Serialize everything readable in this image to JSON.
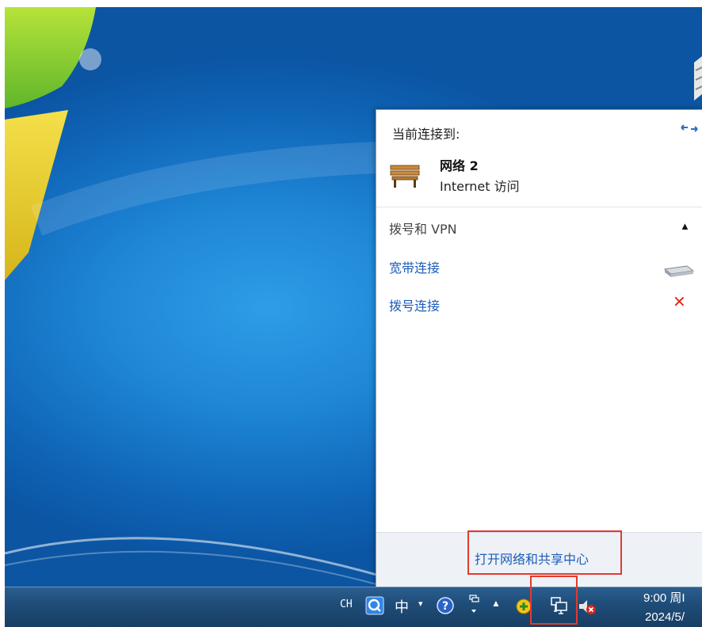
{
  "popup": {
    "current_label": "当前连接到:",
    "network_name": "网络  2",
    "network_access": "Internet 访问",
    "section_title": "拨号和 VPN",
    "connections": [
      {
        "label": "宽带连接"
      },
      {
        "label": "拨号连接"
      }
    ],
    "open_center": "打开网络和共享中心"
  },
  "taskbar": {
    "lang": "CH",
    "ime_mode": "中",
    "clock_time": "9:00 周I",
    "clock_date": "2024/5/"
  },
  "colors": {
    "highlight": "#e23a2f",
    "link": "#1c5cb8",
    "desktop": "#1e86d6"
  }
}
